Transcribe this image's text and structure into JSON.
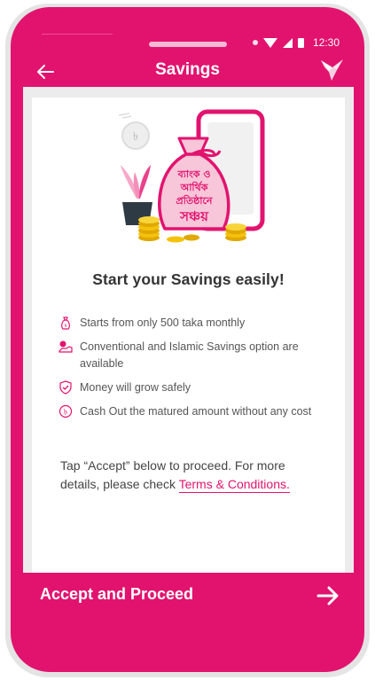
{
  "status_bar": {
    "time": "12:30"
  },
  "app_bar": {
    "title": "Savings"
  },
  "hero": {
    "bag_text_line1": "ব্যাংক ও",
    "bag_text_line2": "আর্থিক",
    "bag_text_line3": "প্রতিষ্ঠানে",
    "bag_text_line4": "সঞ্চয়"
  },
  "headline": "Start your Savings easily!",
  "features": [
    {
      "icon": "money-bag-icon",
      "text": "Starts from only 500 taka monthly"
    },
    {
      "icon": "hand-coin-icon",
      "text": "Conventional and Islamic Savings option are available"
    },
    {
      "icon": "shield-check-icon",
      "text": "Money will grow safely"
    },
    {
      "icon": "taka-coin-icon",
      "text": "Cash Out the matured amount without any cost"
    }
  ],
  "note": {
    "text": "Tap “Accept” below to proceed. For more details, please check ",
    "link": "Terms & Conditions."
  },
  "cta": {
    "label": "Accept and Proceed"
  },
  "colors": {
    "brand": "#e2136e",
    "gold": "#f4c20d"
  }
}
